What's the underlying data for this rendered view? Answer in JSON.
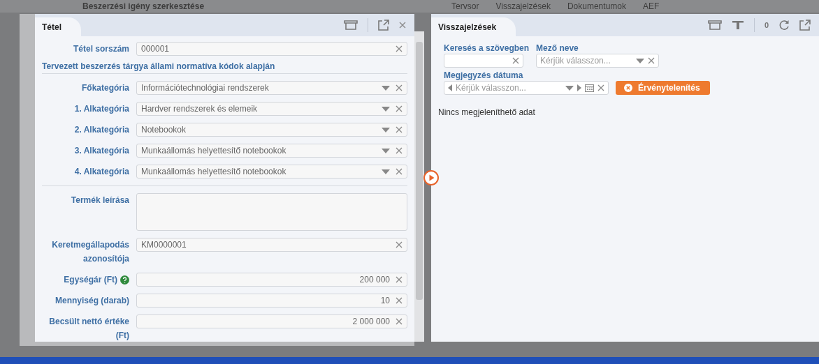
{
  "background": {
    "title": "Beszerzési igény szerkesztése",
    "tabs": [
      "Tervsor",
      "Visszajelzések",
      "Dokumentumok",
      "AEF"
    ]
  },
  "item_panel": {
    "title": "Tétel",
    "fields": [
      {
        "kind": "text",
        "label": "Tétel sorszám",
        "value": "000001"
      },
      {
        "kind": "heading",
        "label": "Tervezett beszerzés tárgya állami normatíva kódok alapján"
      },
      {
        "kind": "select",
        "label": "Főkategória",
        "value": "Információtechnológiai rendszerek"
      },
      {
        "kind": "select",
        "label": "1. Alkategória",
        "value": "Hardver rendszerek és elemeik"
      },
      {
        "kind": "select",
        "label": "2. Alkategória",
        "value": "Notebookok"
      },
      {
        "kind": "select",
        "label": "3. Alkategória",
        "value": "Munkaállomás helyettesítő notebookok"
      },
      {
        "kind": "select",
        "label": "4. Alkategória",
        "value": "Munkaállomás helyettesítő notebookok"
      },
      {
        "kind": "textarea",
        "label": "Termék leírása"
      },
      {
        "kind": "text",
        "label": "Keretmegállapodás azonosítója",
        "value": "KM0000001"
      },
      {
        "kind": "number",
        "label": "Egységár (Ft)",
        "help": true,
        "value": "200 000"
      },
      {
        "kind": "number",
        "label": "Mennyiség (darab)",
        "help": false,
        "value": "10"
      },
      {
        "kind": "number",
        "label": "Becsült nettó értéke (Ft)",
        "help": false,
        "value": "2 000 000"
      }
    ]
  },
  "feedback_panel": {
    "title": "Visszajelzések",
    "count": "0",
    "search_label": "Keresés a szövegben",
    "field_label": "Mező neve",
    "field_placeholder": "Kérjük válasszon...",
    "date_label": "Megjegyzés dátuma",
    "date_placeholder": "Kérjük válasszon...",
    "clear_button": "Érvénytelenítés",
    "empty_message": "Nincs megjeleníthető adat"
  }
}
